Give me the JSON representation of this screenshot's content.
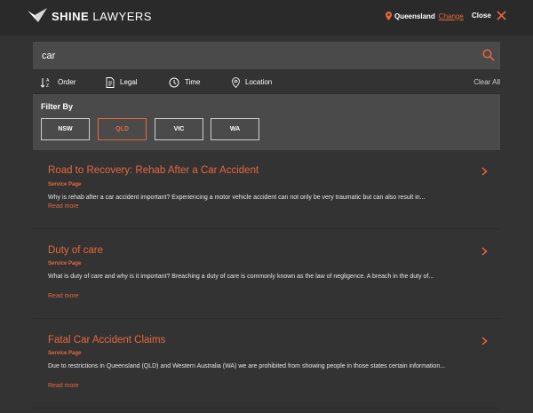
{
  "header": {
    "logo_bold": "SHINE",
    "logo_light": "LAWYERS",
    "region": "Queensland",
    "change_label": "Change",
    "close_label": "Close"
  },
  "search": {
    "value": "car"
  },
  "filter_tabs": {
    "order": "Order",
    "legal": "Legal",
    "time": "Time",
    "location": "Location",
    "clear_all": "Clear All",
    "active": "Location"
  },
  "filter_panel": {
    "title": "Filter By",
    "options": [
      "NSW",
      "QLD",
      "VIC",
      "WA"
    ],
    "selected": "QLD"
  },
  "results": [
    {
      "title": "Road to Recovery: Rehab After a Car Accident",
      "type": "Service Page",
      "description": "Why is rehab after a car accident important? Experiencing a motor vehicle accident can not only be very traumatic but can also result in...",
      "read_more": "Read more"
    },
    {
      "title": "Duty of care",
      "type": "Service Page",
      "description": "What is duty of care and why is it important? Breaching a duty of care is commonly known as the law of negligence. A breach in the duty of...",
      "read_more": "Read more"
    },
    {
      "title": "Fatal Car Accident Claims",
      "type": "Service Page",
      "description": "Due to restrictions in Queensland (QLD) and Western Australia (WA) we are prohibited from showing people in those states certain information...",
      "read_more": "Read more"
    }
  ],
  "colors": {
    "accent": "#e8673c",
    "background": "#333333",
    "header": "#2a2a2a",
    "panel": "#4a4a4a"
  }
}
